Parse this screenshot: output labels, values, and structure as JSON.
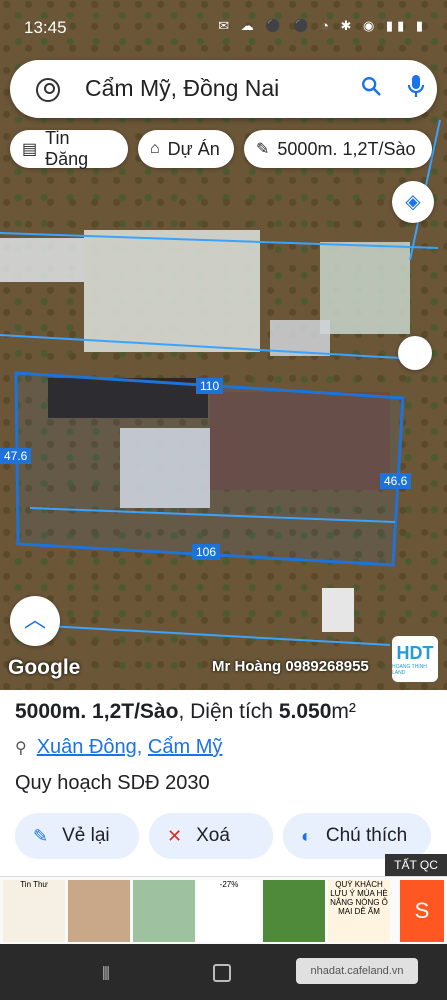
{
  "status_bar": {
    "time": "13:45",
    "icons": "✉ ☁ ⚫ ⚫ ◔ ✱ ◉ ▮▮ ▮"
  },
  "search": {
    "query": "Cẩm Mỹ, Đồng Nai",
    "icons": [
      "account-icon",
      "search-icon",
      "mic-icon"
    ]
  },
  "chips": [
    {
      "label": "Tin Đăng",
      "icon": "▤"
    },
    {
      "label": "Dự Án",
      "icon": "⌂"
    },
    {
      "label": "5000m. 1,2T/Sào",
      "icon": "✎"
    }
  ],
  "map": {
    "branding": "Google",
    "owner_text": "Mr Hoàng 0989268955",
    "logo_mark": "HDT",
    "logo_name": "HOANG THINH LAND",
    "dimension_labels": {
      "top": "110",
      "left": "47.6",
      "right": "46.6",
      "bottom": "106"
    }
  },
  "listing": {
    "title_prefix": "5000m. 1,2T/Sào",
    "title_area_label": ", Diện tích ",
    "area_value": "5.050",
    "area_unit": "m²",
    "location_1": "Xuân Đông",
    "location_sep": ", ",
    "location_2": "Cẩm Mỹ",
    "description": "Quy hoạch SDĐ 2030"
  },
  "actions": [
    {
      "label": "Vẻ lại",
      "icon": "✎"
    },
    {
      "label": "Xoá",
      "icon": "✕"
    },
    {
      "label": "Chú thích",
      "icon": "◐"
    }
  ],
  "ad": {
    "tag": "TẤT QC",
    "tiles": [
      {
        "text": "Tin Thư",
        "bg": "#f5efe4"
      },
      {
        "text": "",
        "bg": "#c9a789"
      },
      {
        "text": "",
        "bg": "#9ec2a0"
      },
      {
        "text": "-27%",
        "bg": "#ffffff"
      },
      {
        "text": "",
        "bg": "#4f8a3a"
      },
      {
        "text": "QUÝ KHÁCH LƯU Ý MÙA HÈ NẮNG NÓNG Ô MAI DỄ ẨM",
        "bg": "#fff4e0"
      }
    ]
  },
  "nav": {
    "watermark": "nhadat.cafeland.vn"
  }
}
